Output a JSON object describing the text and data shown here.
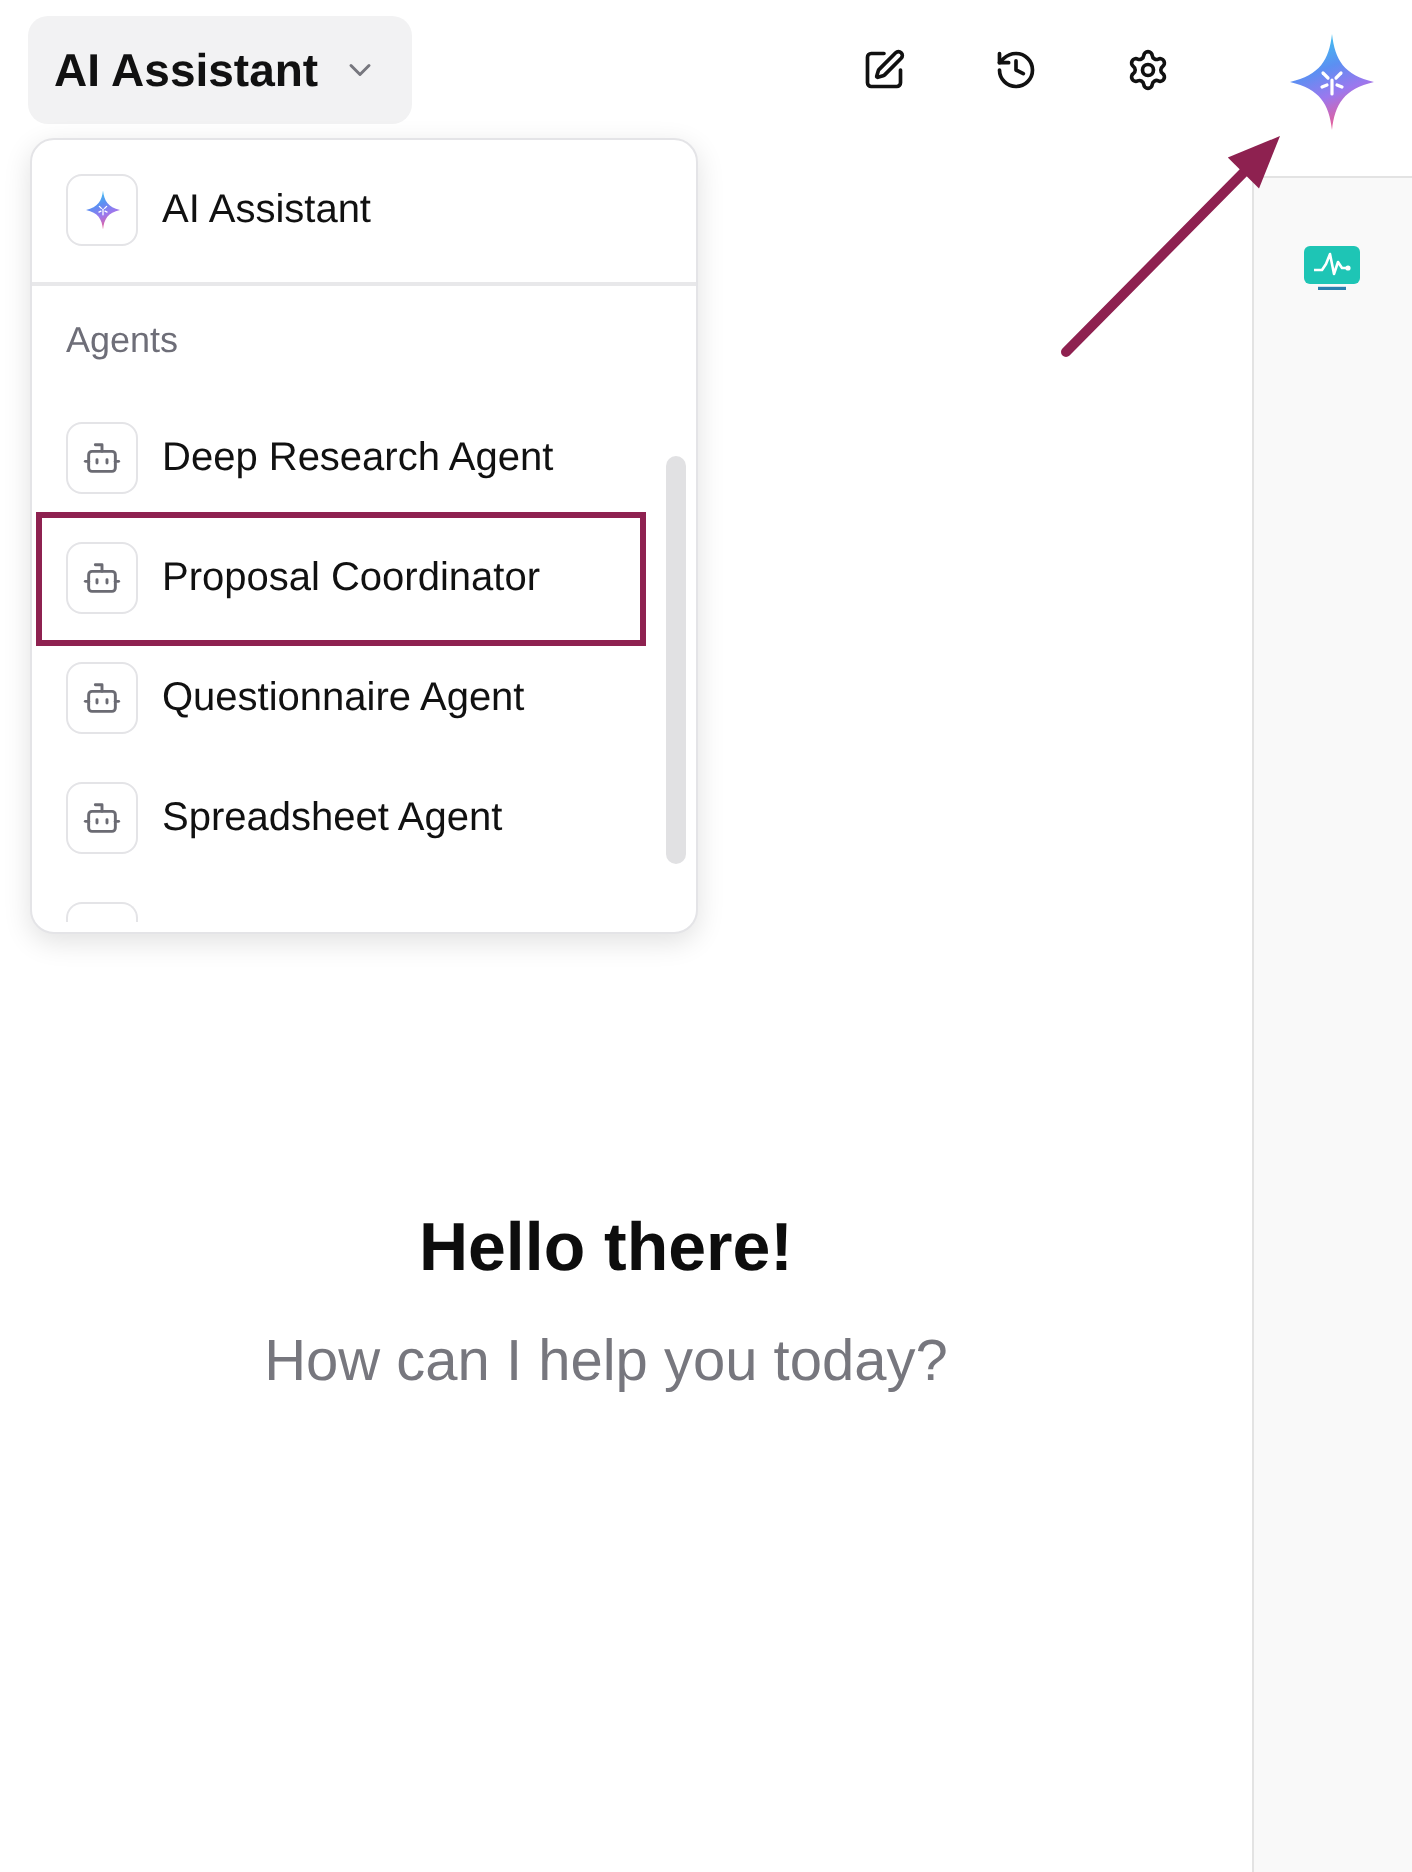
{
  "header": {
    "assistant_dropdown": {
      "label": "AI Assistant",
      "expanded": true
    },
    "toolbar": [
      {
        "kind": "compose"
      },
      {
        "kind": "history"
      },
      {
        "kind": "settings"
      }
    ],
    "logo": {
      "annotation_arrow": true
    }
  },
  "menu": {
    "assistant_item": {
      "label": "AI Assistant"
    },
    "section_label": "Agents",
    "agents": [
      {
        "label": "Deep Research Agent",
        "annotated": false
      },
      {
        "label": "Proposal Coordinator",
        "annotated": true
      },
      {
        "label": "Questionnaire Agent",
        "annotated": false
      },
      {
        "label": "Spreadsheet Agent",
        "annotated": false
      }
    ],
    "more_below": true
  },
  "side_rail": {
    "items": [
      {
        "kind": "monitor"
      }
    ]
  },
  "greeting": {
    "title": "Hello there!",
    "subtitle": "How can I help you today?"
  }
}
